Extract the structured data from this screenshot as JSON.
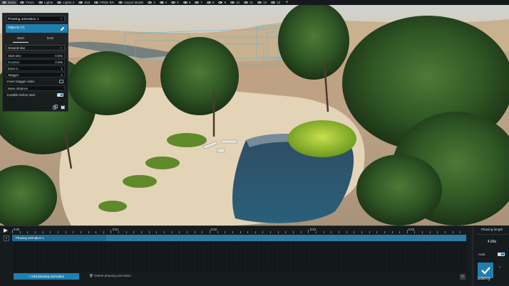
{
  "layers": [
    {
      "label": "Basis",
      "active": true
    },
    {
      "label": "Tree1"
    },
    {
      "label": "Lights"
    },
    {
      "label": "Lights 2"
    },
    {
      "label": "Exit"
    },
    {
      "label": "FREE BG"
    },
    {
      "label": "Import Model"
    },
    {
      "label": "3"
    },
    {
      "label": "4"
    },
    {
      "label": "5"
    },
    {
      "label": "6"
    },
    {
      "label": "7"
    },
    {
      "label": "8"
    },
    {
      "label": "9"
    },
    {
      "label": "10"
    },
    {
      "label": "11"
    },
    {
      "label": "12"
    },
    {
      "label": "13"
    }
  ],
  "panel": {
    "name": "Phasing animation 1",
    "objects_label": "Objects (7)",
    "tabs": [
      "Start",
      "End"
    ],
    "selected_tab": "Start",
    "preset": "Ground rise",
    "rows": {
      "start_time": {
        "label": "Start time",
        "value": "0.00s"
      },
      "duration": {
        "label": "Duration",
        "value": "0.00s"
      },
      "ease_in": {
        "label": "Ease in",
        "value": "1"
      },
      "stagger": {
        "label": "Stagger",
        "value": "1"
      },
      "invert_stagger": {
        "label": "Invert stagger order"
      },
      "move_distance": {
        "label": "Move distance"
      },
      "invisible_before_start": {
        "label": "Invisible before start"
      }
    }
  },
  "timeline": {
    "ticks": [
      "0:00",
      "0:01",
      "0:02",
      "0:03",
      "0:04"
    ],
    "track_index": "1",
    "track_label": "Phasing animation 1",
    "add_button": "Add phasing animation",
    "delete_button": "Delete phasing animation"
  },
  "right_panel": {
    "title": "Phasing length",
    "value": "4.68s",
    "auto_label": "Auto"
  },
  "watermark": "udemy",
  "colors": {
    "accent": "#1f7fb1",
    "panel_bg": "#14181b",
    "track": "#1f6b93"
  }
}
